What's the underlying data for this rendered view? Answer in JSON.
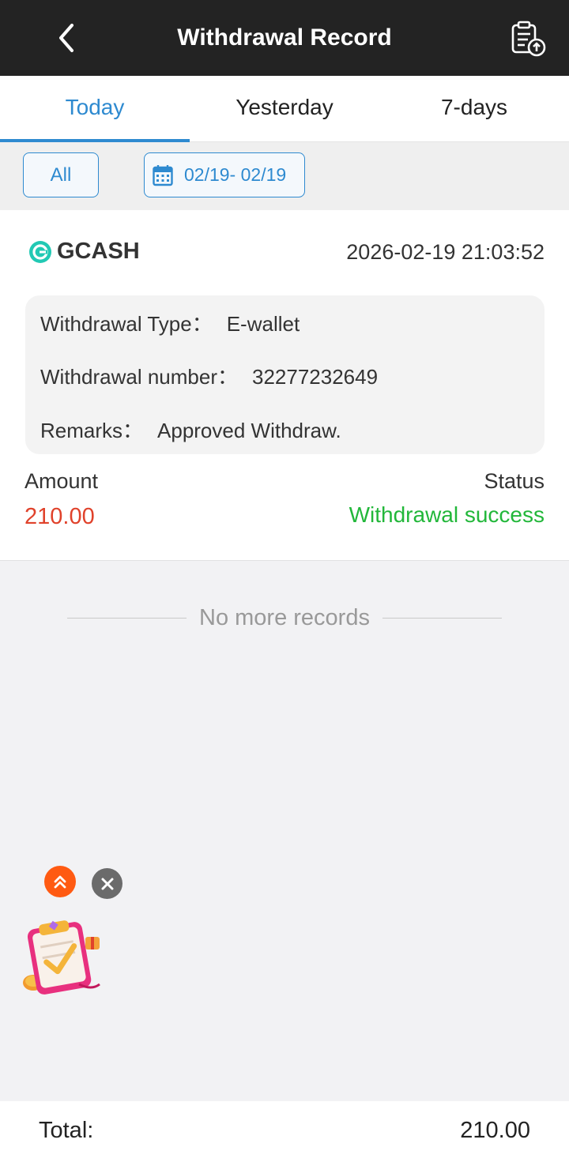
{
  "header": {
    "title": "Withdrawal Record"
  },
  "tabs": [
    {
      "label": "Today",
      "active": true
    },
    {
      "label": "Yesterday",
      "active": false
    },
    {
      "label": "7-days",
      "active": false
    }
  ],
  "filters": {
    "type_label": "All",
    "date_range": "02/19- 02/19"
  },
  "record": {
    "method": "GCASH",
    "datetime": "2026-02-19 21:03:52",
    "type_label": "Withdrawal Type：",
    "type_value": "E-wallet",
    "number_label": "Withdrawal number：",
    "number_value": "32277232649",
    "remarks_label": "Remarks：",
    "remarks_value": "Approved Withdraw.",
    "amount_label": "Amount",
    "amount_value": "210.00",
    "status_label": "Status",
    "status_value": "Withdrawal success"
  },
  "list_end": "No more records",
  "footer": {
    "total_label": "Total:",
    "total_value": "210.00"
  },
  "colors": {
    "accent": "#2e8ad0",
    "amount": "#e0422b",
    "success": "#22b73a",
    "header_bg": "#232323"
  },
  "icons": [
    "back-arrow-icon",
    "clipboard-upload-icon",
    "calendar-icon",
    "gcash-logo-icon",
    "double-chevron-up-icon",
    "close-icon",
    "promo-checklist-icon"
  ]
}
